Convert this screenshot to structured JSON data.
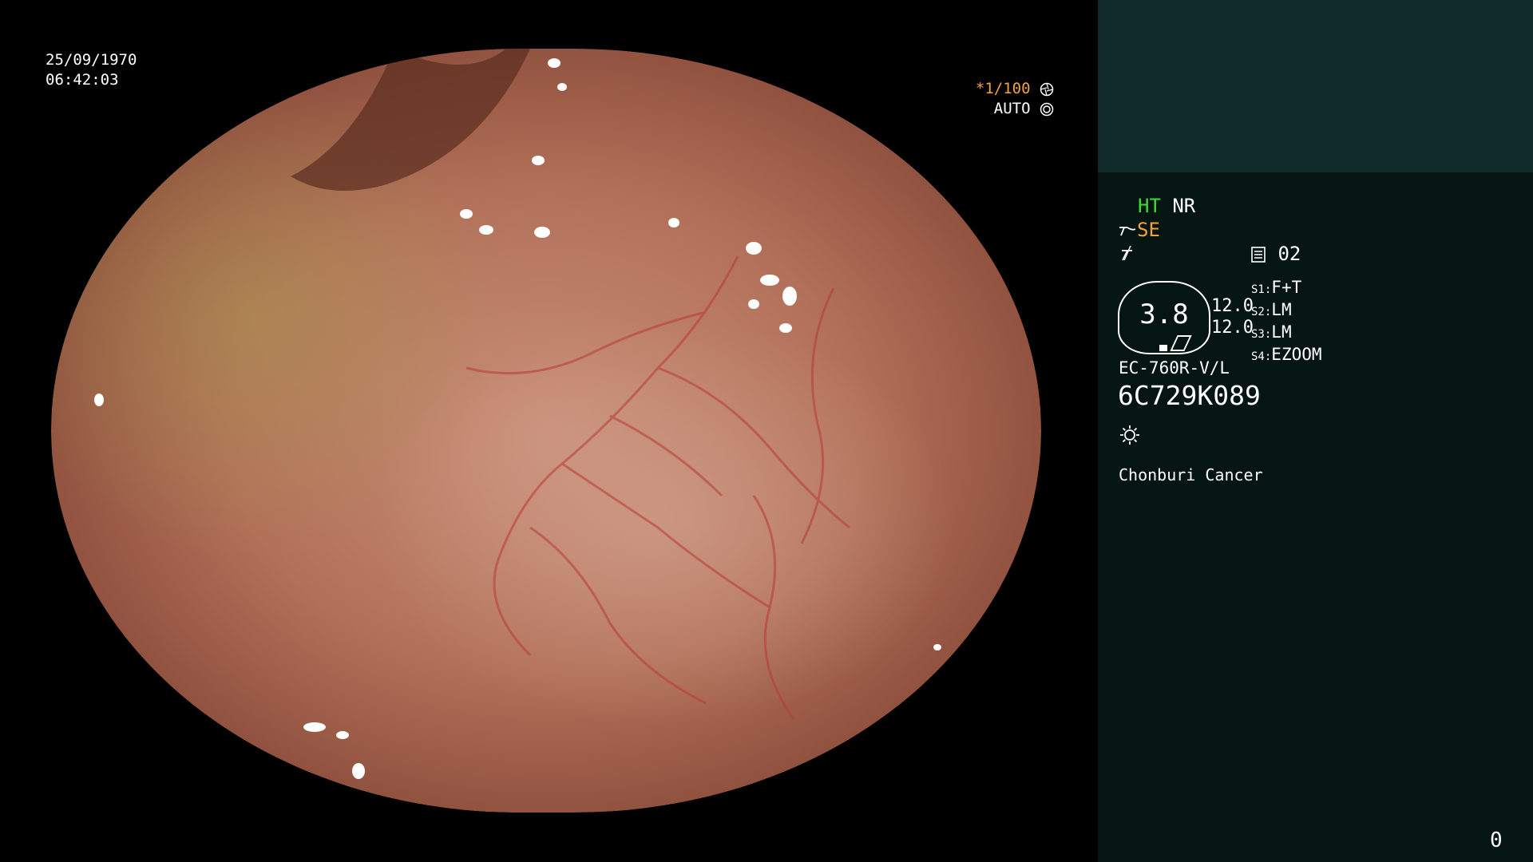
{
  "osd": {
    "date": "25/09/1970",
    "time": "06:42:03",
    "shutter": "*1/100",
    "iris": "AUTO",
    "shutter_icon": "aperture-icon",
    "iris_icon": "iris-icon"
  },
  "panel": {
    "mode_ht": "HT",
    "mode_nr": "NR",
    "mode_se": "SE",
    "memory_number": "02",
    "gauge_value": "3.8",
    "level_top": "12.0",
    "level_bottom": "12.0",
    "presets": [
      {
        "tag": "S1:",
        "value": "F+T"
      },
      {
        "tag": "S2:",
        "value": "LM"
      },
      {
        "tag": "S3:",
        "value": "LM"
      },
      {
        "tag": "S4:",
        "value": "EZOOM"
      }
    ],
    "scope_model": "EC-760R-V/L",
    "scope_serial": "6C729K089",
    "hospital": "Chonburi Cancer",
    "counter": "0"
  },
  "colors": {
    "ht_green": "#3ddc3a",
    "se_orange": "#f2a33a",
    "panel_bg": "#051512",
    "panel_top_bg": "#0f2b2b"
  }
}
